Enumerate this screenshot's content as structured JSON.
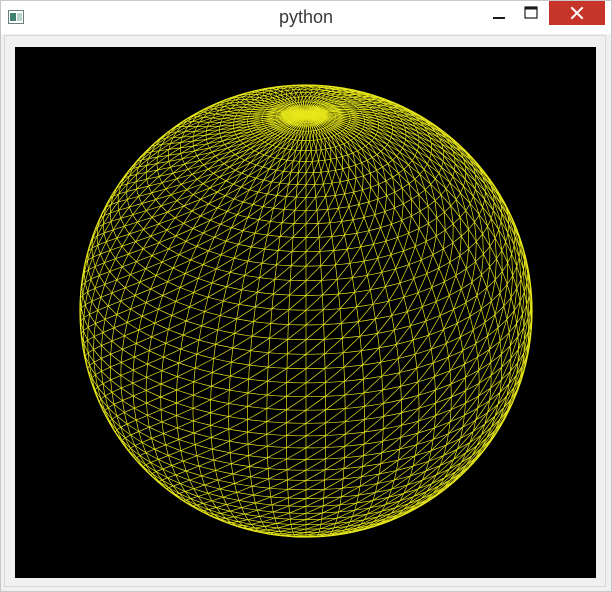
{
  "window": {
    "title": "python",
    "controls": {
      "minimize": "minimize",
      "maximize": "maximize",
      "close": "close"
    }
  },
  "canvas": {
    "background": "#000000",
    "mesh_color": "#e6e61a",
    "shape": "wireframe-sphere",
    "meridians": 72,
    "parallels": 48
  },
  "colors": {
    "close_button": "#c7352a"
  }
}
